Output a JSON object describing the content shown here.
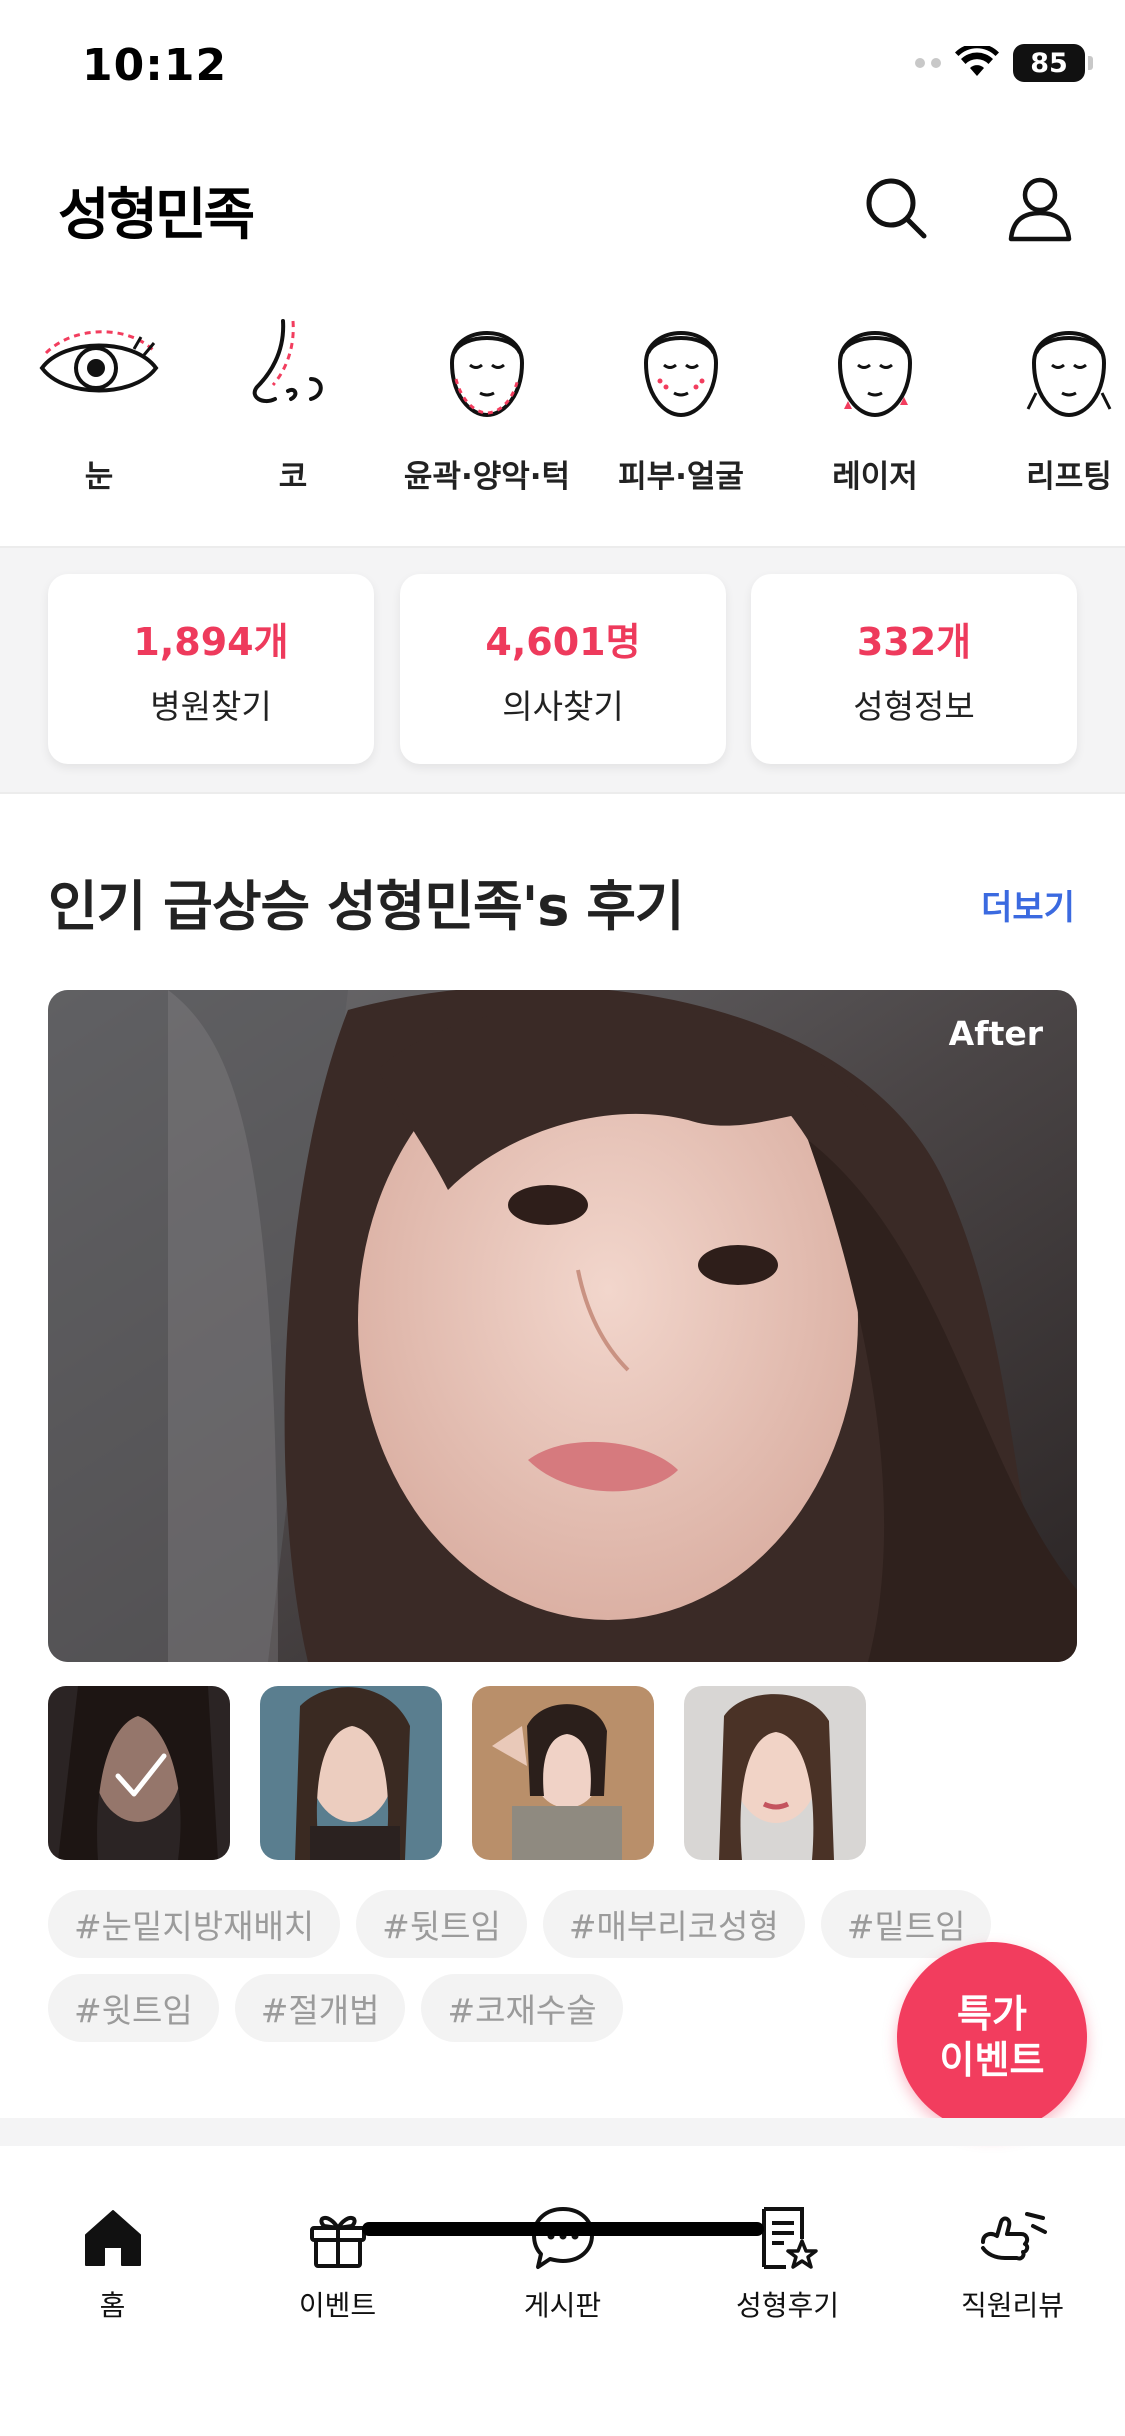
{
  "status_bar": {
    "time": "10:12",
    "battery": "85"
  },
  "header": {
    "logo": "성형민족",
    "search_icon": "search-icon",
    "user_icon": "user-icon"
  },
  "categories": [
    {
      "label": "눈",
      "icon": "eye-icon"
    },
    {
      "label": "코",
      "icon": "nose-icon"
    },
    {
      "label": "윤곽·양악·턱",
      "icon": "face-contour-icon"
    },
    {
      "label": "피부·얼굴",
      "icon": "face-skin-icon"
    },
    {
      "label": "레이저",
      "icon": "face-laser-icon"
    },
    {
      "label": "리프팅",
      "icon": "face-lifting-icon"
    }
  ],
  "stats": [
    {
      "value": "1,894개",
      "label": "병원찾기"
    },
    {
      "value": "4,601명",
      "label": "의사찾기"
    },
    {
      "value": "332개",
      "label": "성형정보"
    }
  ],
  "reviews_section": {
    "title": "인기 급상승 성형민족's 후기",
    "more": "더보기",
    "photo_badge": "After",
    "tags": [
      "#눈밑지방재배치",
      "#뒷트임",
      "#매부리코성형",
      "#밑트임",
      "#윗트임",
      "#절개법",
      "#코재수술"
    ]
  },
  "fab": {
    "line1": "특가",
    "line2": "이벤트"
  },
  "bottom_nav": [
    {
      "label": "홈",
      "icon": "home-icon"
    },
    {
      "label": "이벤트",
      "icon": "gift-icon"
    },
    {
      "label": "게시판",
      "icon": "chat-bubble-icon"
    },
    {
      "label": "성형후기",
      "icon": "review-doc-icon"
    },
    {
      "label": "직원리뷰",
      "icon": "thumbs-down-icon"
    }
  ],
  "colors": {
    "accent": "#f23d5e",
    "stat_number": "#ee3a5c",
    "link": "#3b6ae0"
  }
}
